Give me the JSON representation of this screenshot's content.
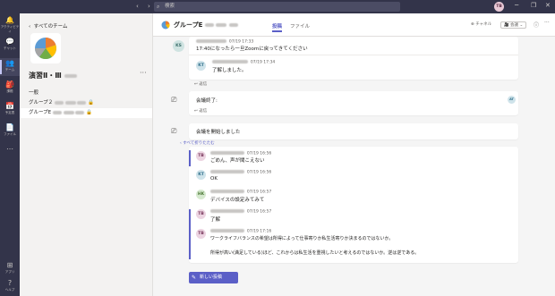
{
  "titlebar": {
    "search_placeholder": "検索",
    "user_initials": "TB",
    "nav_arrows": "‹ ›",
    "min": "─",
    "restore": "❐",
    "close": "✕"
  },
  "rail": [
    {
      "label": "アクティビティ",
      "icon": "bell-icon",
      "glyph": "🔔"
    },
    {
      "label": "チャット",
      "icon": "chat-icon",
      "glyph": "💬"
    },
    {
      "label": "チーム",
      "icon": "teams-icon",
      "glyph": "👥"
    },
    {
      "label": "課題",
      "icon": "assignments-icon",
      "glyph": "🎒"
    },
    {
      "label": "予定表",
      "icon": "calendar-icon",
      "glyph": "📅"
    },
    {
      "label": "ファイル",
      "icon": "files-icon",
      "glyph": "📄"
    },
    {
      "label": "…",
      "icon": "more-icon",
      "glyph": "⋯"
    }
  ],
  "rail_bottom": [
    {
      "label": "アプリ",
      "icon": "apps-icon",
      "glyph": "⊞"
    },
    {
      "label": "ヘルプ",
      "icon": "help-icon",
      "glyph": "?"
    }
  ],
  "leftpane": {
    "back_label": "すべてのチーム",
    "team_name": "演習Ⅱ・Ⅲ",
    "more": "···",
    "channels": [
      {
        "label": "一般",
        "locked": false,
        "selected": false
      },
      {
        "label": "グループ２",
        "locked": true,
        "selected": false
      },
      {
        "label": "グループE",
        "locked": true,
        "selected": true
      }
    ]
  },
  "header": {
    "channel_title": "グループE",
    "tabs": [
      "投稿",
      "ファイル"
    ],
    "team_btn": "⊕ チャネル",
    "meet_btn": "会議",
    "info": "ⓘ",
    "more": "···"
  },
  "messages": {
    "m1": {
      "initials": "KS",
      "time": "07/19 17:33",
      "text": "17:40になったら一旦Zoomに戻ってきてください"
    },
    "m1r": {
      "initials": "KT",
      "time": "07/19 17:34",
      "text": "了解しました。"
    },
    "reply_label": "↩ 返信",
    "meeting_end": {
      "text": "会議終了:",
      "badge": "AT"
    },
    "meeting_start": {
      "text": "会議を開始しました"
    },
    "expand_label": "‹ すべて折りたたむ",
    "thread": [
      {
        "initials": "TB",
        "time": "07/19 16:56",
        "text": "ごめん、声が聞こえない",
        "color": "tb"
      },
      {
        "initials": "KT",
        "time": "07/19 16:56",
        "text": "OK",
        "color": "kt"
      },
      {
        "initials": "HK",
        "time": "07/19 16:57",
        "text": "デバイスの設定みてみて",
        "color": "hk"
      },
      {
        "initials": "TB",
        "time": "07/19 16:57",
        "text": "了解",
        "color": "tb"
      },
      {
        "initials": "TB",
        "time": "07/19 17:16",
        "text": "ワークライフバランスの希望は所得によって仕事寄りか私生活寄りか決まるのではないか。",
        "text2": "所得が高い(満足している)ほど、これからは私生活を重視したいと考えるのではないか。逆は逆である。",
        "color": "tb"
      }
    ]
  },
  "newpost_label": "新しい投稿",
  "colors": {
    "brand": "#5b5fc7",
    "rail": "#33344a",
    "presence": "#92c353"
  }
}
